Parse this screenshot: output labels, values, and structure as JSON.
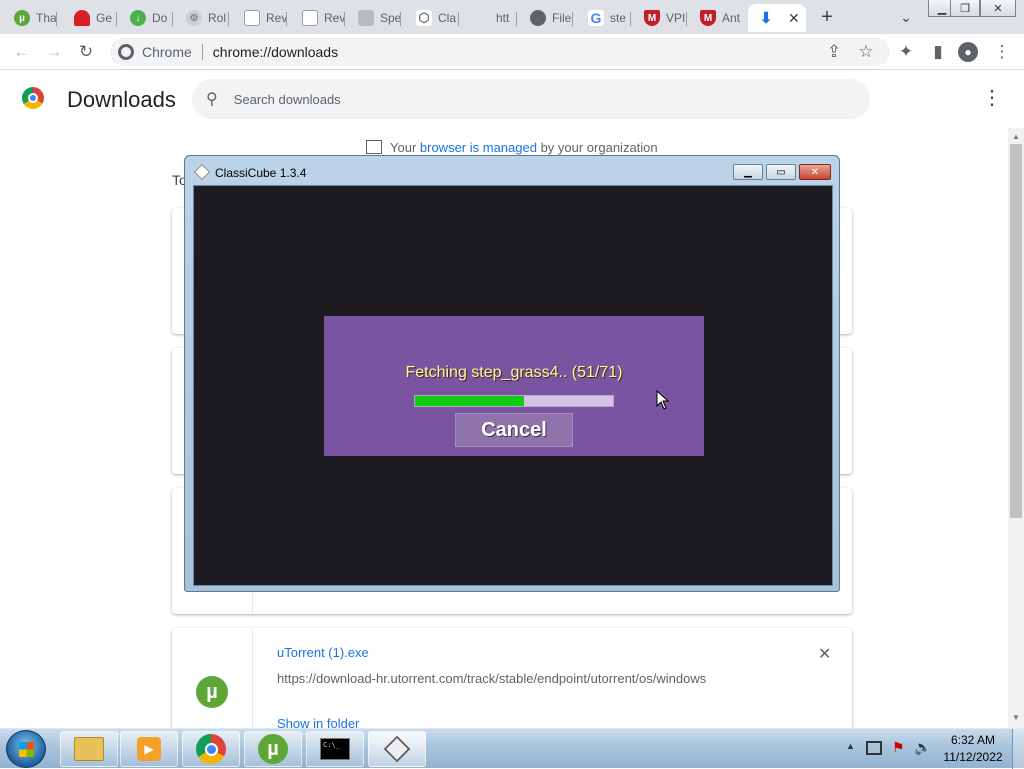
{
  "browser": {
    "tabs": [
      {
        "label": "Tha",
        "icon": "utorrent-icon",
        "color": "#5fa636"
      },
      {
        "label": "Ge",
        "icon": "ghost-icon",
        "color": "#d61f26"
      },
      {
        "label": "Do",
        "icon": "download-icon",
        "color": "#4caf50"
      },
      {
        "label": "Rol",
        "icon": "gear-icon",
        "color": "#c0c0c0"
      },
      {
        "label": "Rev",
        "icon": "page-icon",
        "color": "#9aa0a6"
      },
      {
        "label": "Rev",
        "icon": "page-icon",
        "color": "#9aa0a6"
      },
      {
        "label": "Spe",
        "icon": "disk-icon",
        "color": "#9aa0a6"
      },
      {
        "label": "Cla",
        "icon": "cube-icon",
        "color": "#9aa0a6"
      },
      {
        "label": "htt",
        "icon": "blank-icon",
        "color": "#dee1e6"
      },
      {
        "label": "File",
        "icon": "globe-icon",
        "color": "#5f6368"
      },
      {
        "label": "ste",
        "icon": "google-icon",
        "color": "#4285f4"
      },
      {
        "label": "VPI",
        "icon": "shield-icon",
        "color": "#c0202a"
      },
      {
        "label": "Ant",
        "icon": "shield-icon",
        "color": "#c0202a"
      }
    ],
    "active_tab_icon": "download-icon",
    "site_label": "Chrome",
    "url": "chrome://downloads"
  },
  "downloads": {
    "title": "Downloads",
    "search_placeholder": "Search downloads",
    "managed_prefix": "Your ",
    "managed_link": "browser is managed",
    "managed_suffix": " by your organization",
    "date_partial": "To",
    "items": [
      {
        "filename": "uTorrent (1).exe",
        "url": "https://download-hr.utorrent.com/track/stable/endpoint/utorrent/os/windows",
        "action": "Show in folder"
      }
    ]
  },
  "classicube": {
    "window_title": "ClassiCube 1.3.4",
    "status": "Fetching step_grass4.. (51/71)",
    "progress": 0.55,
    "cancel_label": "Cancel"
  },
  "taskbar": {
    "time": "6:32 AM",
    "date": "11/12/2022",
    "cmd_text": "C:\\_"
  },
  "colors": {
    "accent": "#1a73e8",
    "dialog": "#7a54a0",
    "progress_fill": "#12cc12"
  }
}
